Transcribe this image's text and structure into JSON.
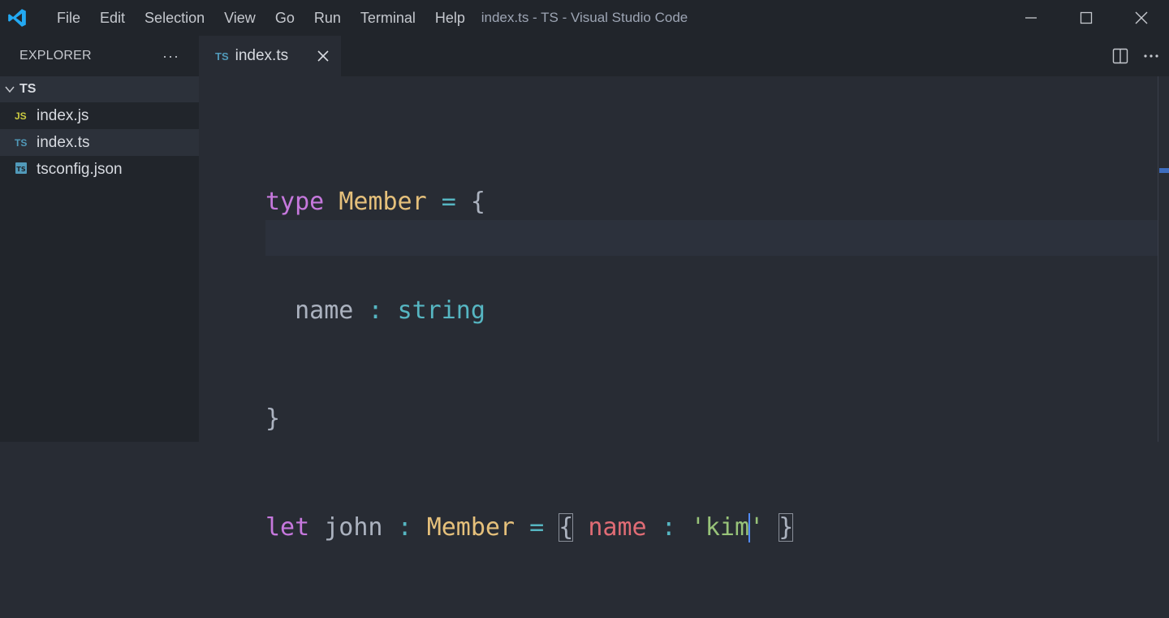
{
  "window": {
    "title": "index.ts - TS - Visual Studio Code"
  },
  "menu": [
    "File",
    "Edit",
    "Selection",
    "View",
    "Go",
    "Run",
    "Terminal",
    "Help"
  ],
  "sidebar": {
    "title": "EXPLORER",
    "folder": "TS",
    "files": [
      {
        "icon": "JS",
        "icon_color": "#cbcb41",
        "label": "index.js",
        "active": false
      },
      {
        "icon": "TS",
        "icon_color": "#519aba",
        "label": "index.ts",
        "active": true
      },
      {
        "icon": "TS",
        "icon_color": "#519aba",
        "label": "tsconfig.json",
        "active": false
      }
    ]
  },
  "tab": {
    "icon": "TS",
    "label": "index.ts"
  },
  "code": {
    "line1": {
      "kw": "type",
      "name": "Member",
      "eq": "=",
      "brace": "{"
    },
    "line2": {
      "prop": "name",
      "colon": ":",
      "type": "string"
    },
    "line3": {
      "brace": "}"
    },
    "line4": {
      "kw": "let",
      "var": "john",
      "colon": ":",
      "type": "Member",
      "eq": "=",
      "open": "{",
      "prop": "name",
      "colon2": ":",
      "str_before_cursor": "'kim",
      "str_after_cursor": "'",
      "close": "}"
    }
  },
  "colors": {
    "accent": "#528bff",
    "keyword": "#c678dd",
    "type": "#e5c07b",
    "operator": "#56b6c2",
    "property": "#e06c75",
    "string": "#98c379"
  }
}
